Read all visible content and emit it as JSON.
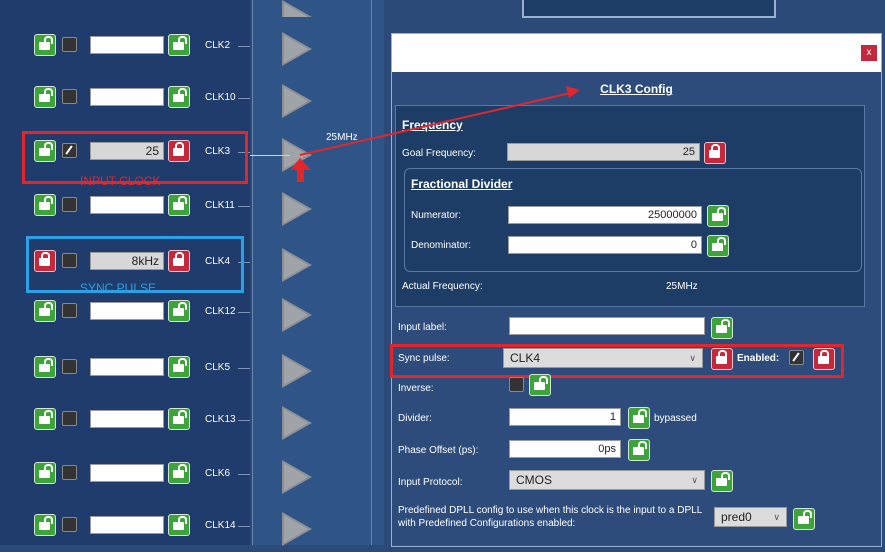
{
  "clock_list": [
    {
      "label": "CLK2",
      "value": "",
      "locked": false,
      "pen": false
    },
    {
      "label": "CLK10",
      "value": "",
      "locked": false,
      "pen": false
    },
    {
      "label": "CLK3",
      "value": "25",
      "locked": true,
      "pen": true
    },
    {
      "label": "CLK11",
      "value": "",
      "locked": false,
      "pen": false
    },
    {
      "label": "CLK4",
      "value": "8kHz",
      "locked": true,
      "pen": false
    },
    {
      "label": "CLK12",
      "value": "",
      "locked": false,
      "pen": false
    },
    {
      "label": "CLK5",
      "value": "",
      "locked": false,
      "pen": false
    },
    {
      "label": "CLK13",
      "value": "",
      "locked": false,
      "pen": false
    },
    {
      "label": "CLK6",
      "value": "",
      "locked": false,
      "pen": false
    },
    {
      "label": "CLK14",
      "value": "",
      "locked": false,
      "pen": false
    }
  ],
  "annotations": {
    "input_clock": "INPUT CLOCK",
    "sync_pulse": "SYNC PULSE",
    "freq_label": "25MHz"
  },
  "dialog": {
    "close": "x",
    "title": "CLK3 Config",
    "frequency": {
      "heading": "Frequency",
      "goal_label": "Goal Frequency:",
      "goal_value": "25",
      "fractional": {
        "heading": "Fractional Divider",
        "numerator_label": "Numerator:",
        "numerator_value": "25000000",
        "denominator_label": "Denominator:",
        "denominator_value": "0"
      },
      "actual_label": "Actual Frequency:",
      "actual_value": "25MHz"
    },
    "input_label_label": "Input label:",
    "input_label_value": "",
    "sync_pulse_label": "Sync pulse:",
    "sync_pulse_value": "CLK4",
    "enabled_label": "Enabled:",
    "inverse_label": "Inverse:",
    "divider_label": "Divider:",
    "divider_value": "1",
    "bypassed_label": "bypassed",
    "phase_offset_label": "Phase Offset (ps):",
    "phase_offset_value": "0ps",
    "input_protocol_label": "Input Protocol:",
    "input_protocol_value": "CMOS",
    "predefined_label": "Predefined DPLL config to use when this clock is the input to a DPLL with Predefined Configurations enabled:",
    "predefined_value": "pred0"
  },
  "colors": {
    "annotation_red": "#e3262c",
    "annotation_blue": "#2aa1e3",
    "lock_green": "#3fa33b",
    "lock_red": "#c4283a"
  }
}
